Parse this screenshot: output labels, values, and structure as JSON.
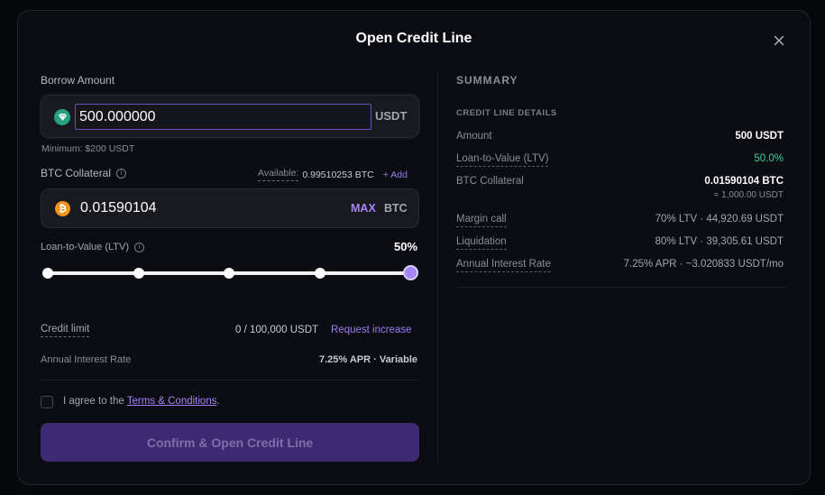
{
  "modal": {
    "title": "Open Credit Line"
  },
  "borrow": {
    "label": "Borrow Amount",
    "value": "500.000000",
    "unit": "USDT",
    "minimum": "Minimum: $200 USDT"
  },
  "collateral": {
    "label": "BTC Collateral",
    "available_label": "Available:",
    "available_value": "0.99510253 BTC",
    "add_label": "+ Add",
    "value": "0.01590104",
    "max_label": "MAX",
    "unit": "BTC"
  },
  "ltv": {
    "label": "Loan-to-Value (LTV)",
    "value_text": "50%",
    "slider_steps": 5,
    "slider_selected_index": 4
  },
  "credit_limit": {
    "label": "Credit limit",
    "value": "0 / 100,000 USDT",
    "request_label": "Request increase"
  },
  "interest": {
    "label": "Annual Interest Rate",
    "value": "7.25% APR · Variable"
  },
  "agreement": {
    "prefix": "I agree to the ",
    "terms_label": "Terms & Conditions",
    "suffix": "."
  },
  "confirm_label": "Confirm & Open Credit Line",
  "summary": {
    "title": "SUMMARY",
    "details_title": "CREDIT LINE DETAILS",
    "amount_label": "Amount",
    "amount_value": "500 USDT",
    "ltv_label": "Loan-to-Value (LTV)",
    "ltv_value": "50.0%",
    "collateral_label": "BTC Collateral",
    "collateral_value": "0.01590104 BTC",
    "collateral_usd": "≈ 1,000.00 USDT",
    "margin_label": "Margin call",
    "margin_value": "70% LTV · 44,920.69 USDT",
    "liquidation_label": "Liquidation",
    "liquidation_value": "80% LTV · 39,305.61 USDT",
    "apr_label": "Annual Interest Rate",
    "apr_value": "7.25% APR · ~3.020833 USDT/mo"
  },
  "colors": {
    "accent": "#9b7cf2",
    "positive": "#2fd39a",
    "tether": "#26a17b",
    "bitcoin": "#f2931a"
  }
}
